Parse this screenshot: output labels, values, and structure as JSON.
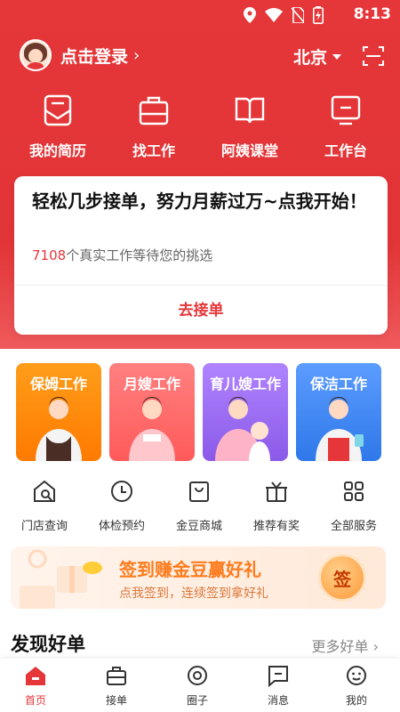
{
  "status_bar": {
    "time": "8:13"
  },
  "header": {
    "login_text": "点击登录",
    "login_arrow": "›",
    "city": "北京"
  },
  "quick_nav": [
    {
      "label": "我的简历",
      "icon": "resume-icon"
    },
    {
      "label": "找工作",
      "icon": "briefcase-icon"
    },
    {
      "label": "阿姨课堂",
      "icon": "book-icon"
    },
    {
      "label": "工作台",
      "icon": "monitor-icon"
    }
  ],
  "promo_card": {
    "title": "轻松几步接单，努力月薪过万~点我开始！",
    "count": "7108",
    "count_suffix": "个真实工作等待您的挑选",
    "cta": "去接单"
  },
  "service_tiles": [
    {
      "label": "保姆工作",
      "color": "#ff8a00"
    },
    {
      "label": "月嫂工作",
      "color": "#ff6c6c"
    },
    {
      "label": "育儿嫂工作",
      "color": "#9b6cf0"
    },
    {
      "label": "保洁工作",
      "color": "#3b84f0"
    }
  ],
  "services": [
    {
      "label": "门店查询",
      "icon": "store-search-icon"
    },
    {
      "label": "体检预约",
      "icon": "clock-icon"
    },
    {
      "label": "金豆商城",
      "icon": "shopping-bag-icon"
    },
    {
      "label": "推荐有奖",
      "icon": "gift-icon"
    },
    {
      "label": "全部服务",
      "icon": "grid-icon"
    }
  ],
  "signin_banner": {
    "headline": "签到赚金豆赢好礼",
    "subline": "点我签到，连续签到拿好礼",
    "button": "签"
  },
  "discover": {
    "title": "发现好单",
    "more": "更多好单 ›"
  },
  "tabbar": [
    {
      "label": "首页",
      "icon": "home-icon",
      "active": true
    },
    {
      "label": "接单",
      "icon": "briefcase-icon",
      "active": false
    },
    {
      "label": "圈子",
      "icon": "circle-icon",
      "active": false
    },
    {
      "label": "消息",
      "icon": "message-icon",
      "active": false
    },
    {
      "label": "我的",
      "icon": "user-face-icon",
      "active": false
    }
  ],
  "colors": {
    "brand_red": "#e53639",
    "signin_orange": "#ff7a1a"
  }
}
